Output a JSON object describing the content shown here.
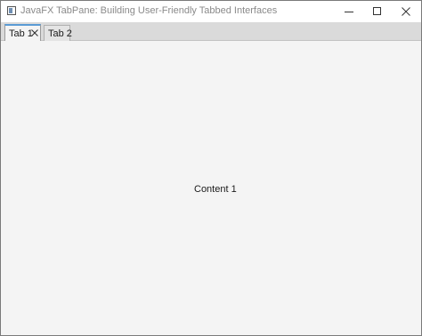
{
  "window": {
    "title": "JavaFX TabPane: Building User-Friendly Tabbed Interfaces",
    "controls": {
      "minimize": "minimize-icon",
      "maximize": "maximize-icon",
      "close": "close-icon"
    }
  },
  "tabs": [
    {
      "label": "Tab 1",
      "selected": true,
      "closable": true
    },
    {
      "label": "Tab 2",
      "selected": false,
      "closable": false
    }
  ],
  "content": {
    "text": "Content 1"
  },
  "colors": {
    "selected_tab_accent": "#5a9bd5",
    "tab_header_bg": "#dadada",
    "content_bg": "#f4f4f4"
  }
}
